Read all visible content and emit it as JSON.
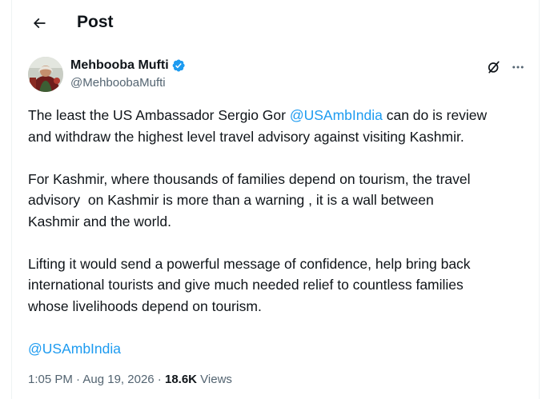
{
  "header": {
    "back_icon": "arrow-left-icon",
    "title": "Post"
  },
  "author": {
    "name": "Mehbooba Mufti",
    "handle": "@MehboobaMufti",
    "verified": true,
    "verified_color": "#1d9bf0"
  },
  "actions": {
    "grok_icon": "grok-icon",
    "more_icon": "more-horizontal-icon"
  },
  "tweet": {
    "p1": {
      "line1_before": "The least the US Ambassador Sergio Gor ",
      "line1_mention": "@USAmbIndia",
      "line1_after": " can do is review",
      "line2": "and withdraw the highest level travel advisory against visiting Kashmir."
    },
    "p2": {
      "line1": "For Kashmir, where thousands of families depend on tourism, the travel",
      "line2": "advisory  on Kashmir is more than a warning , it is a wall between",
      "line3": "Kashmir and the world."
    },
    "p3": {
      "line1": "Lifting it would send a powerful message of confidence, help bring back",
      "line2": "international tourists and give much needed relief to countless families",
      "line3": "whose livelihoods depend on tourism."
    },
    "final_mention": "@USAmbIndia"
  },
  "meta": {
    "time": "1:05 PM",
    "separator": " · ",
    "date": "Aug 19, 2026",
    "views_count": "18.6K",
    "views_label": " Views"
  },
  "colors": {
    "text": "#0f1419",
    "secondary": "#536471",
    "link": "#1d9bf0"
  }
}
